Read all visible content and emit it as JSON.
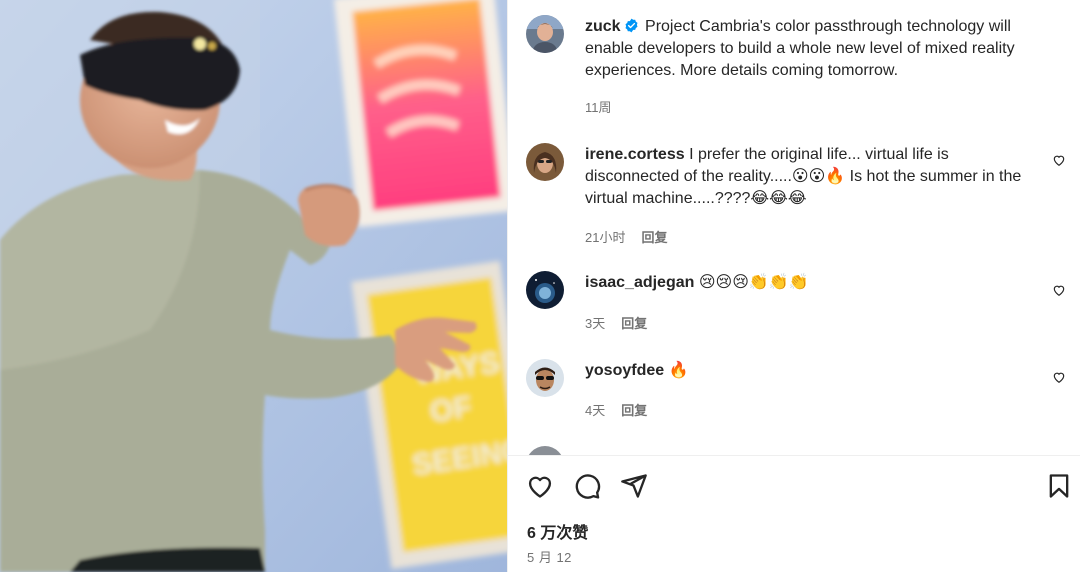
{
  "post": {
    "author": "zuck",
    "caption": "Project Cambria's color passthrough technology will enable developers to build a whole new level of mixed reality experiences. More details coming tomorrow.",
    "time": "11周"
  },
  "comments": [
    {
      "username": "irene.cortess",
      "text": "I prefer the original life... virtual life is disconnected of the reality.....😮😮🔥 Is hot the summer in the virtual machine.....????😂😂😂",
      "time": "21小时",
      "reply_label": "回复"
    },
    {
      "username": "isaac_adjegan",
      "text": "😢😢😢👏👏👏",
      "time": "3天",
      "reply_label": "回复"
    },
    {
      "username": "yosoyfdee",
      "text": "🔥",
      "time": "4天",
      "reply_label": "回复"
    }
  ],
  "footer": {
    "likes": "6 万次赞",
    "date": "5 月 12"
  },
  "icons": {
    "like": "heart-icon",
    "comment": "comment-bubble-icon",
    "share": "paper-plane-icon",
    "save": "bookmark-icon",
    "verified": "verified-badge-icon"
  },
  "colors": {
    "text": "#262626",
    "secondary": "#737373",
    "verified": "#0095f6",
    "divider": "#efefef"
  }
}
